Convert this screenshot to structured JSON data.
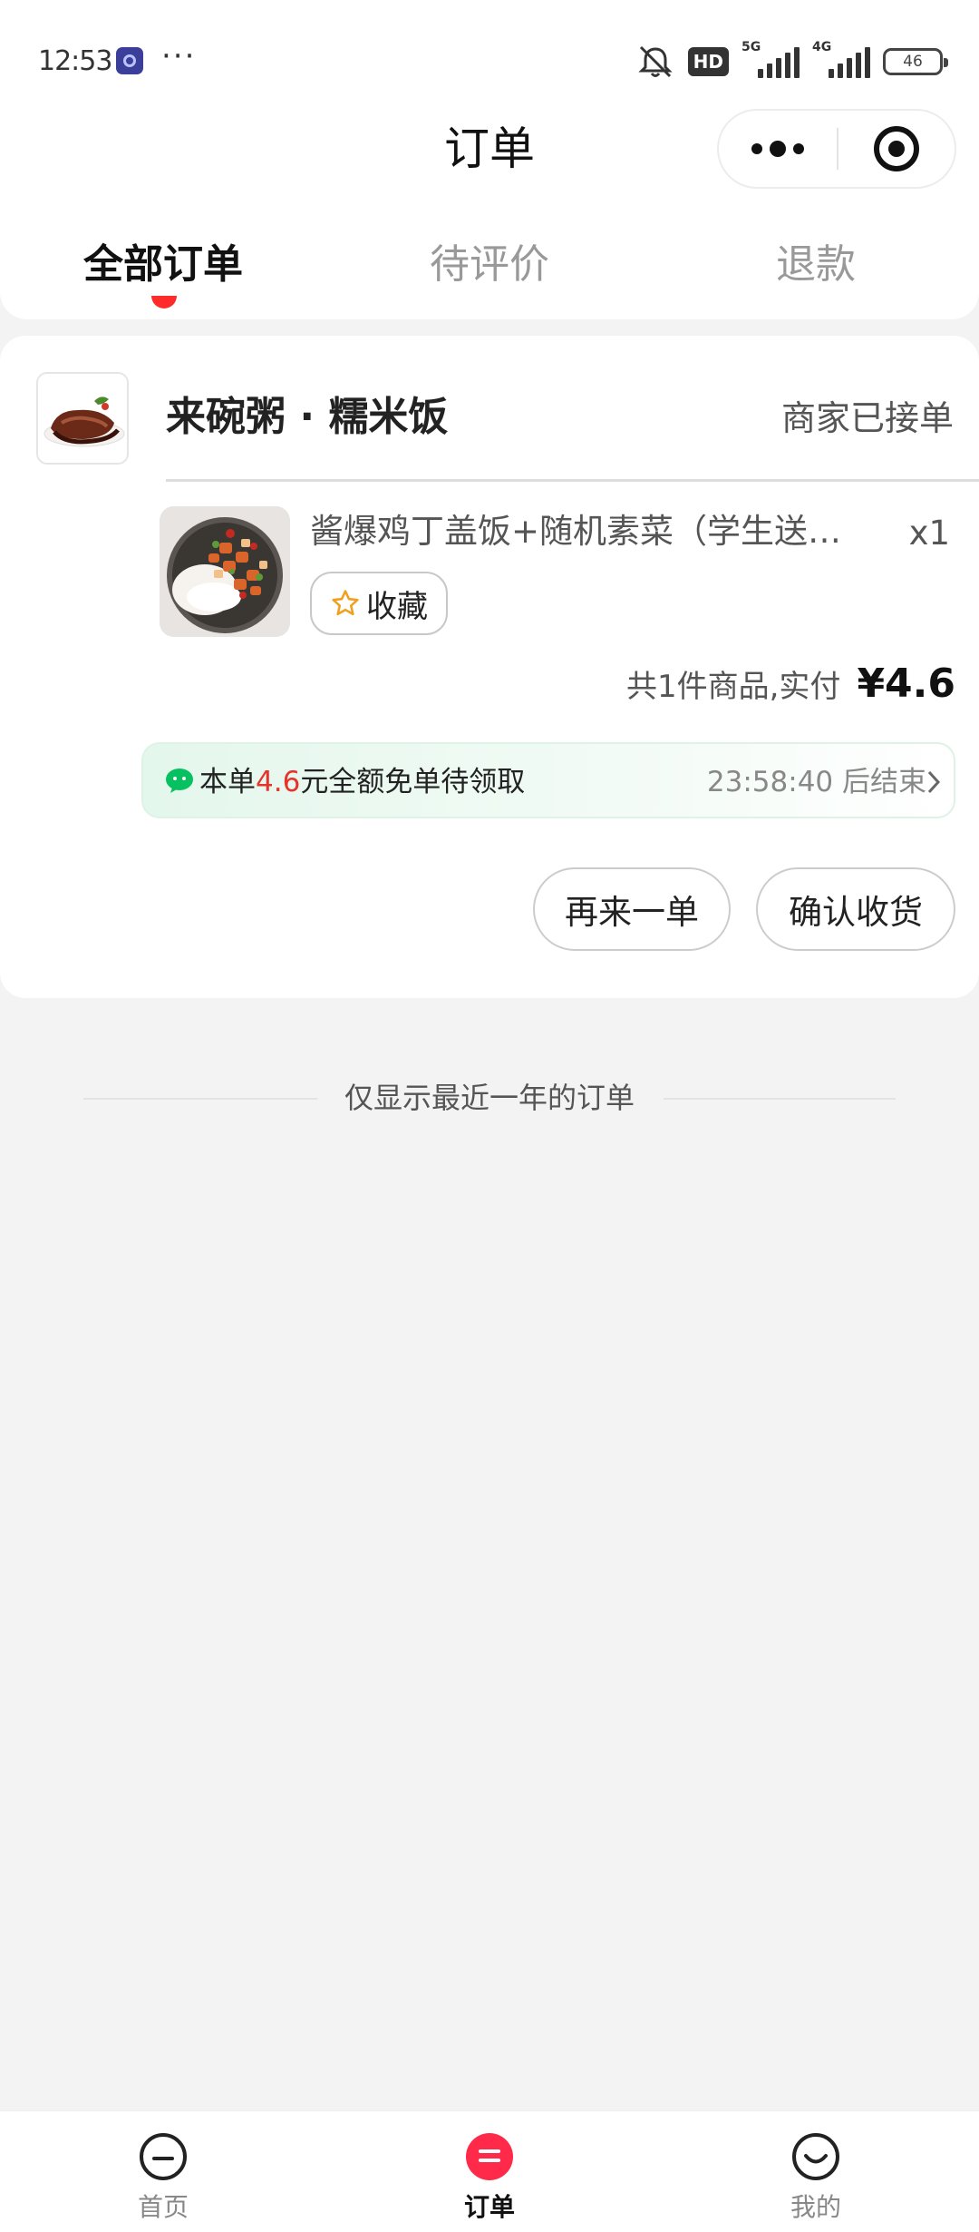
{
  "status_bar": {
    "time": "12:53",
    "more": "···",
    "hd_label": "HD",
    "network_1": "5G",
    "network_2": "4G",
    "battery": "46"
  },
  "header": {
    "title": "订单",
    "capsule_more_icon": "more-dots-icon",
    "capsule_close_icon": "target-icon"
  },
  "tabs": [
    {
      "label": "全部订单",
      "active": true
    },
    {
      "label": "待评价",
      "active": false
    },
    {
      "label": "退款",
      "active": false
    }
  ],
  "order": {
    "shop_name": "来碗粥 · 糯米饭",
    "status": "商家已接单",
    "item_name": "酱爆鸡丁盖饭+随机素菜（学生送饮料）",
    "item_qty": "x1",
    "favorite_label": "收藏",
    "total_text": "共1件商品,实付",
    "total_price": "¥4.6",
    "banner_prefix": "本单",
    "banner_amount": "4.6",
    "banner_suffix": "元全额免单待领取",
    "banner_countdown": "23:58:40 后结束",
    "reorder_label": "再来一单",
    "confirm_label": "确认收货"
  },
  "footer_note": "仅显示最近一年的订单",
  "bottom_nav": [
    {
      "label": "首页",
      "icon": "home-face-icon",
      "active": false
    },
    {
      "label": "订单",
      "icon": "order-icon",
      "active": true
    },
    {
      "label": "我的",
      "icon": "smiley-icon",
      "active": false
    }
  ],
  "colors": {
    "accent_red": "#ff2a2a",
    "price_red": "#e5342b",
    "wechat_green": "#07c160",
    "star_orange": "#f0a020"
  }
}
